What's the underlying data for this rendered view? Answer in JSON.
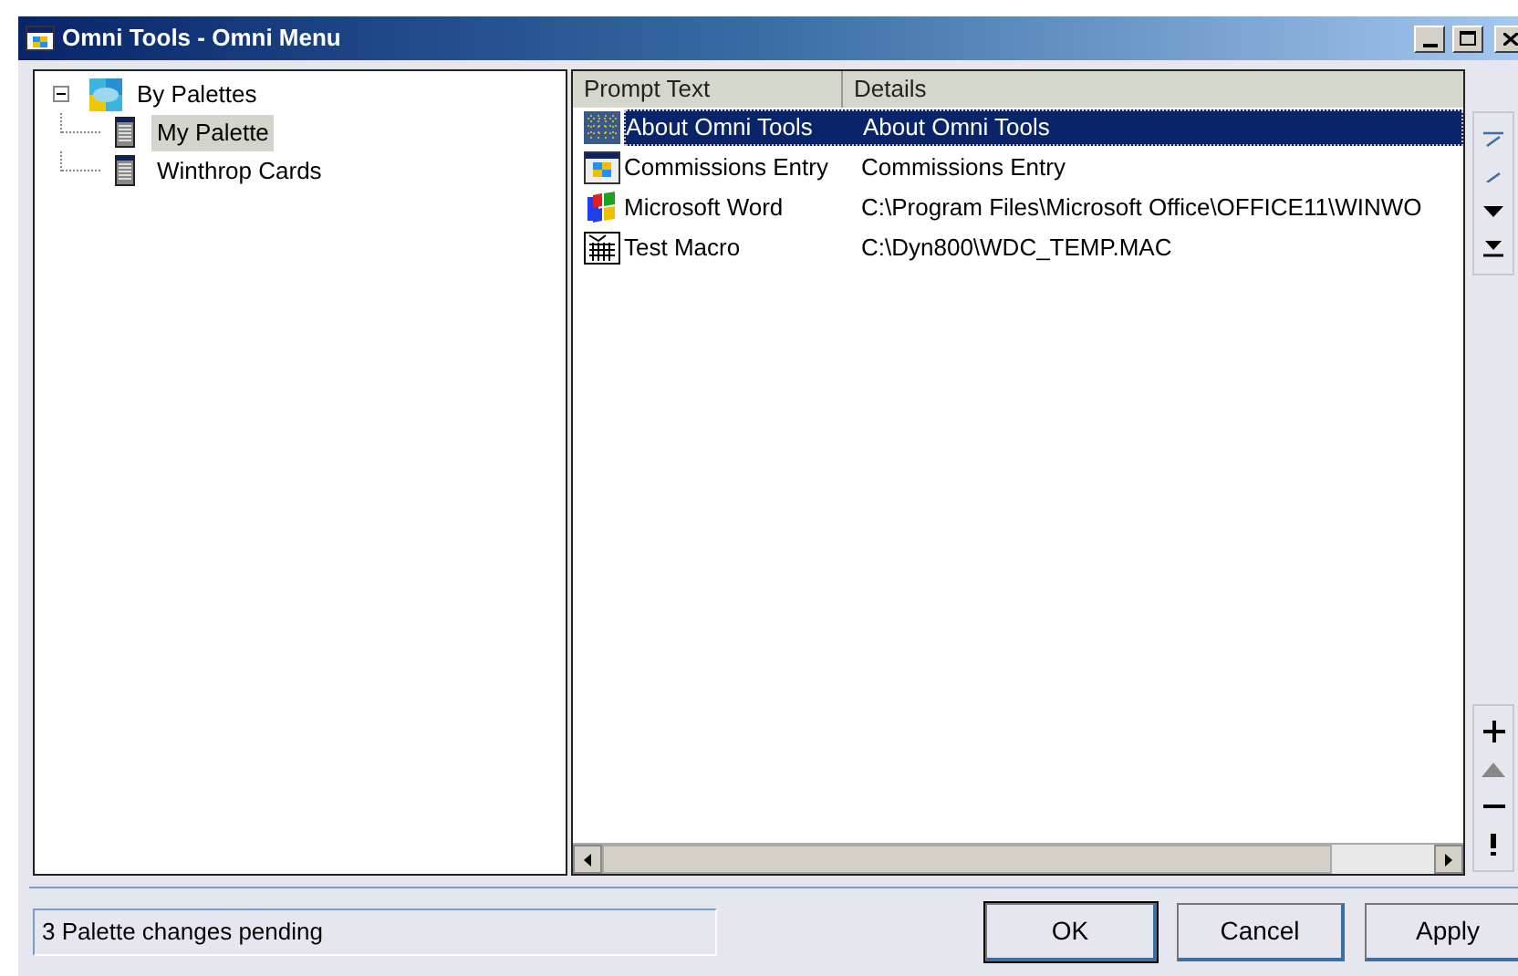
{
  "window": {
    "title": "Omni Tools - Omni Menu"
  },
  "tree": [
    {
      "label": "By Palettes",
      "expanded": true,
      "selected": false,
      "children": [
        {
          "label": "My Palette",
          "selected": true
        },
        {
          "label": "Winthrop Cards",
          "selected": false
        }
      ]
    }
  ],
  "table": {
    "columns": [
      "Prompt Text",
      "Details"
    ],
    "rows": [
      {
        "kind": "about",
        "cells": [
          "About Omni Tools",
          "About Omni Tools"
        ],
        "selected": true
      },
      {
        "kind": "form",
        "cells": [
          "Commissions Entry",
          "Commissions Entry"
        ],
        "selected": false
      },
      {
        "kind": "app",
        "cells": [
          "Microsoft Word",
          "C:\\Program Files\\Microsoft Office\\OFFICE11\\WINWO"
        ],
        "selected": false
      },
      {
        "kind": "macro",
        "cells": [
          "Test Macro",
          "C:\\Dyn800\\WDC_TEMP.MAC"
        ],
        "selected": false
      }
    ]
  },
  "status_bar": {
    "text": "3 Palette changes pending"
  },
  "buttons": [
    "OK",
    "Cancel",
    "Apply"
  ]
}
